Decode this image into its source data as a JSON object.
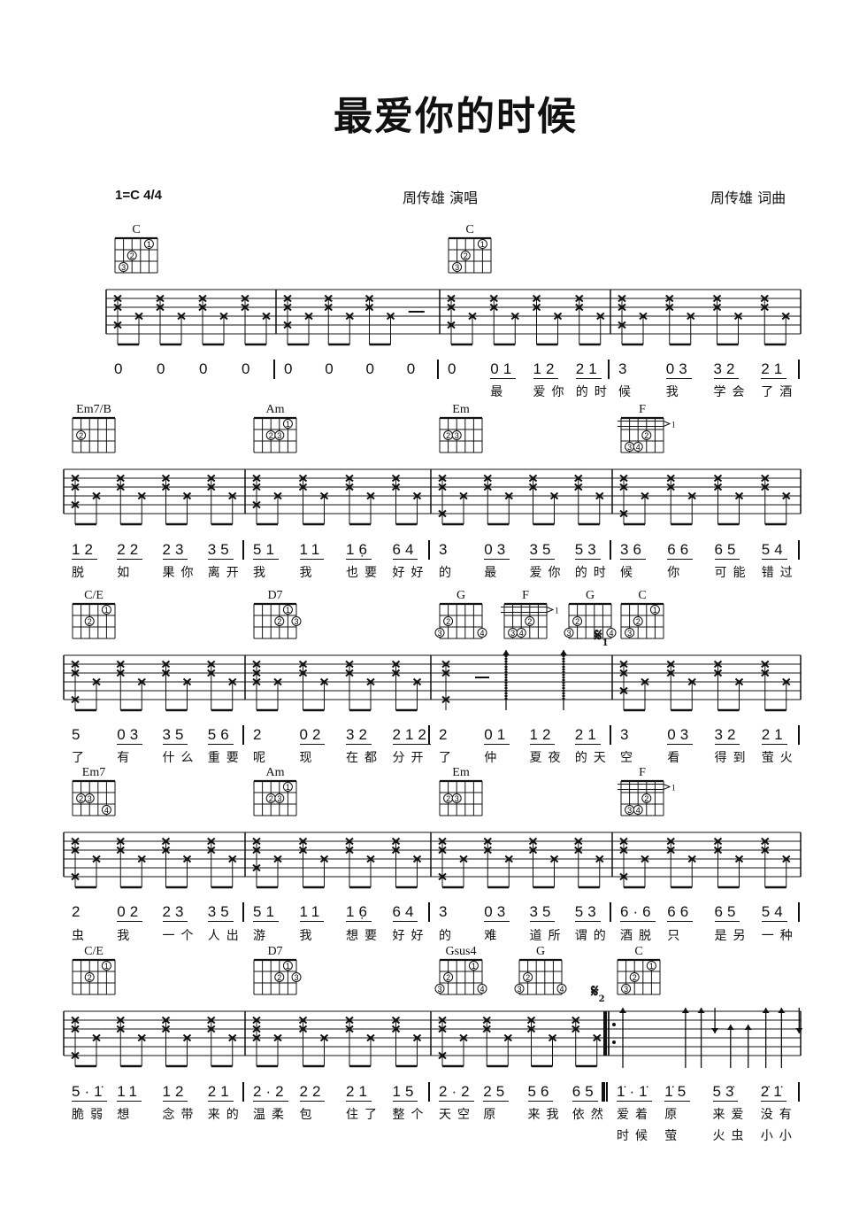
{
  "title": "最爱你的时候",
  "key_signature": "1=C 4/4",
  "singer": "周传雄 演唱",
  "composer": "周传雄 词曲",
  "segno_marks": [
    "1",
    "2"
  ],
  "rows": [
    {
      "measures": [
        {
          "chords": [
            {
              "name": "C",
              "fingers": [
                [
                  2,
                  1,
                  1
                ],
                [
                  4,
                  2,
                  2
                ],
                [
                  5,
                  3,
                  3
                ]
              ]
            }
          ],
          "tab": {
            "pattern": "arpeggio",
            "bass": 5
          },
          "notes": [
            "0",
            "0",
            "0",
            "0"
          ],
          "lyrics": [
            "",
            "",
            "",
            ""
          ]
        },
        {
          "chords": [],
          "tab": {
            "pattern": "arpeggio-rest",
            "bass": 5
          },
          "notes": [
            "0",
            "0",
            "0",
            "0"
          ],
          "lyrics": [
            "",
            "",
            "",
            ""
          ]
        },
        {
          "chords": [
            {
              "name": "C",
              "fingers": [
                [
                  2,
                  1,
                  1
                ],
                [
                  4,
                  2,
                  2
                ],
                [
                  5,
                  3,
                  3
                ]
              ]
            }
          ],
          "tab": {
            "pattern": "arpeggio",
            "bass": 5
          },
          "notes": [
            "0",
            "01",
            "12",
            "21"
          ],
          "lyrics": [
            "",
            "最",
            "爱你",
            "的时"
          ]
        },
        {
          "chords": [],
          "tab": {
            "pattern": "arpeggio",
            "bass": 5
          },
          "notes": [
            "3",
            "03",
            "32",
            "21"
          ],
          "lyrics": [
            "候",
            "我",
            "学会",
            "了酒"
          ]
        }
      ]
    },
    {
      "measures": [
        {
          "chords": [
            {
              "name": "Em7/B",
              "fingers": [
                [
                  5,
                  2,
                  2
                ]
              ]
            }
          ],
          "tab": {
            "pattern": "arpeggio",
            "bass": 5
          },
          "notes": [
            "12",
            "22",
            "23",
            "35"
          ],
          "lyrics": [
            "脱",
            "如",
            "果你",
            "离开"
          ]
        },
        {
          "chords": [
            {
              "name": "Am",
              "fingers": [
                [
                  2,
                  1,
                  1
                ],
                [
                  4,
                  2,
                  2
                ],
                [
                  3,
                  2,
                  3
                ]
              ]
            }
          ],
          "tab": {
            "pattern": "arpeggio",
            "bass": 5
          },
          "notes": [
            "51",
            "11",
            "16̣",
            "64"
          ],
          "lyrics": [
            "我",
            "我",
            "也要",
            "好好"
          ]
        },
        {
          "chords": [
            {
              "name": "Em",
              "fingers": [
                [
                  5,
                  2,
                  2
                ],
                [
                  4,
                  2,
                  3
                ]
              ]
            }
          ],
          "tab": {
            "pattern": "arpeggio",
            "bass": 6
          },
          "notes": [
            "3",
            "03",
            "35",
            "53"
          ],
          "lyrics": [
            "的",
            "最",
            "爱你",
            "的时"
          ]
        },
        {
          "chords": [
            {
              "name": "F",
              "barre": 1,
              "fingers": [
                [
                  3,
                  2,
                  2
                ],
                [
                  5,
                  3,
                  3
                ],
                [
                  4,
                  3,
                  4
                ]
              ]
            }
          ],
          "tab": {
            "pattern": "arpeggio",
            "bass": 6
          },
          "notes": [
            "36",
            "66",
            "65",
            "54"
          ],
          "lyrics": [
            "候",
            "你",
            "可能",
            "错过"
          ]
        }
      ]
    },
    {
      "measures": [
        {
          "chords": [
            {
              "name": "C/E",
              "fingers": [
                [
                  2,
                  1,
                  1
                ],
                [
                  4,
                  2,
                  2
                ]
              ]
            }
          ],
          "tab": {
            "pattern": "arpeggio",
            "bass": 6
          },
          "notes": [
            "5",
            "03",
            "35",
            "56"
          ],
          "lyrics": [
            "了",
            "有",
            "什么",
            "重要"
          ]
        },
        {
          "chords": [
            {
              "name": "D7",
              "fingers": [
                [
                  2,
                  1,
                  1
                ],
                [
                  3,
                  2,
                  2
                ],
                [
                  1,
                  2,
                  3
                ]
              ]
            }
          ],
          "tab": {
            "pattern": "arpeggio",
            "bass": 4
          },
          "notes": [
            "2",
            "02",
            "32",
            "212"
          ],
          "lyrics": [
            "呢",
            "现",
            "在都",
            "分开"
          ]
        },
        {
          "chords": [
            {
              "name": "G",
              "fingers": [
                [
                  5,
                  2,
                  2
                ],
                [
                  6,
                  3,
                  3
                ],
                [
                  1,
                  3,
                  4
                ]
              ]
            },
            {
              "name": "F",
              "barre": 1,
              "fingers": [
                [
                  3,
                  2,
                  2
                ],
                [
                  5,
                  3,
                  3
                ],
                [
                  4,
                  3,
                  4
                ]
              ]
            },
            {
              "name": "G",
              "fingers": [
                [
                  5,
                  2,
                  2
                ],
                [
                  6,
                  3,
                  3
                ],
                [
                  1,
                  3,
                  4
                ]
              ]
            }
          ],
          "tab": {
            "pattern": "break",
            "bass": 6
          },
          "notes": [
            "2",
            "01",
            "12",
            "21"
          ],
          "lyrics": [
            "了",
            "仲",
            "夏夜",
            "的天"
          ]
        },
        {
          "chords": [
            {
              "name": "C",
              "fingers": [
                [
                  2,
                  1,
                  1
                ],
                [
                  4,
                  2,
                  2
                ],
                [
                  5,
                  3,
                  3
                ]
              ]
            }
          ],
          "segno": 0,
          "tab": {
            "pattern": "arpeggio",
            "bass": 5
          },
          "notes": [
            "3",
            "03",
            "32",
            "21"
          ],
          "lyrics": [
            "空",
            "看",
            "得到",
            "萤火"
          ]
        }
      ]
    },
    {
      "measures": [
        {
          "chords": [
            {
              "name": "Em7",
              "fingers": [
                [
                  5,
                  2,
                  2
                ],
                [
                  4,
                  2,
                  3
                ],
                [
                  2,
                  3,
                  4
                ]
              ]
            }
          ],
          "tab": {
            "pattern": "arpeggio",
            "bass": 6
          },
          "notes": [
            "2",
            "02",
            "23",
            "35"
          ],
          "lyrics": [
            "虫",
            "我",
            "一个",
            "人出"
          ]
        },
        {
          "chords": [
            {
              "name": "Am",
              "fingers": [
                [
                  2,
                  1,
                  1
                ],
                [
                  4,
                  2,
                  2
                ],
                [
                  3,
                  2,
                  3
                ]
              ]
            }
          ],
          "tab": {
            "pattern": "arpeggio",
            "bass": 5
          },
          "notes": [
            "51",
            "11",
            "16̣",
            "64"
          ],
          "lyrics": [
            "游",
            "我",
            "想要",
            "好好"
          ]
        },
        {
          "chords": [
            {
              "name": "Em",
              "fingers": [
                [
                  5,
                  2,
                  2
                ],
                [
                  4,
                  2,
                  3
                ]
              ]
            }
          ],
          "tab": {
            "pattern": "arpeggio",
            "bass": 6
          },
          "notes": [
            "3",
            "03",
            "35",
            "53"
          ],
          "lyrics": [
            "的",
            "难",
            "道所",
            "谓的"
          ]
        },
        {
          "chords": [
            {
              "name": "F",
              "barre": 1,
              "fingers": [
                [
                  3,
                  2,
                  2
                ],
                [
                  5,
                  3,
                  3
                ],
                [
                  4,
                  3,
                  4
                ]
              ]
            }
          ],
          "tab": {
            "pattern": "arpeggio",
            "bass": 6
          },
          "notes": [
            "6·6",
            "66",
            "65",
            "54"
          ],
          "lyrics": [
            "酒脱",
            "只",
            "是另",
            "一种"
          ]
        }
      ]
    },
    {
      "measures": [
        {
          "chords": [
            {
              "name": "C/E",
              "fingers": [
                [
                  2,
                  1,
                  1
                ],
                [
                  4,
                  2,
                  2
                ]
              ]
            }
          ],
          "tab": {
            "pattern": "arpeggio",
            "bass": 6
          },
          "notes": [
            "5·1̇",
            "11",
            "12",
            "21"
          ],
          "lyrics": [
            "脆弱",
            "想",
            "念带",
            "来的"
          ]
        },
        {
          "chords": [
            {
              "name": "D7",
              "fingers": [
                [
                  2,
                  1,
                  1
                ],
                [
                  3,
                  2,
                  2
                ],
                [
                  1,
                  2,
                  3
                ]
              ]
            }
          ],
          "tab": {
            "pattern": "arpeggio",
            "bass": 4
          },
          "notes": [
            "2·2",
            "22",
            "21",
            "15"
          ],
          "lyrics": [
            "温柔",
            "包",
            "住了",
            "整个"
          ]
        },
        {
          "chords": [
            {
              "name": "Gsus4",
              "fingers": [
                [
                  2,
                  1,
                  1
                ],
                [
                  5,
                  2,
                  2
                ],
                [
                  6,
                  3,
                  3
                ],
                [
                  1,
                  3,
                  4
                ]
              ]
            },
            {
              "name": "G",
              "fingers": [
                [
                  5,
                  2,
                  2
                ],
                [
                  6,
                  3,
                  3
                ],
                [
                  1,
                  3,
                  4
                ]
              ]
            }
          ],
          "tab": {
            "pattern": "arpeggio",
            "bass": 6
          },
          "notes": [
            "2·2",
            "25",
            "56",
            "65"
          ],
          "lyrics": [
            "天空",
            "原",
            "来我",
            "依然"
          ]
        },
        {
          "chords": [
            {
              "name": "C",
              "fingers": [
                [
                  2,
                  1,
                  1
                ],
                [
                  4,
                  2,
                  2
                ],
                [
                  5,
                  3,
                  3
                ]
              ]
            }
          ],
          "segno": 1,
          "repeat_start": true,
          "tab": {
            "pattern": "strum",
            "bass": 5
          },
          "notes": [
            "1̇·1̇",
            "1̇5",
            "53̇",
            "2̇1̇"
          ],
          "lyrics": [
            "爱着",
            "原",
            "来爱",
            "没有"
          ],
          "lyrics2": [
            "时候",
            "萤",
            "火虫",
            "小小"
          ]
        }
      ]
    }
  ]
}
